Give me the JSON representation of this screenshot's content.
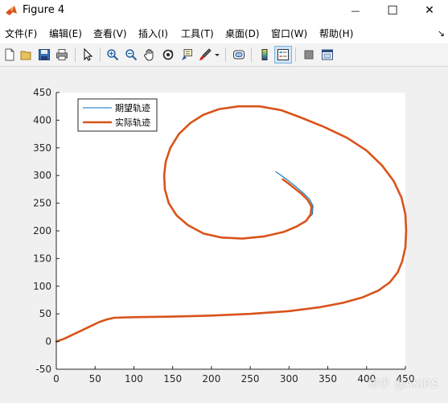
{
  "window": {
    "title": "Figure 4",
    "minimize_glyph": "—",
    "maximize_glyph": "☐",
    "close_glyph": "✕"
  },
  "menu": {
    "items": [
      "文件(F)",
      "编辑(E)",
      "查看(V)",
      "插入(I)",
      "工具(T)",
      "桌面(D)",
      "窗口(W)",
      "帮助(H)"
    ],
    "dock_glyph": "↘"
  },
  "toolbar": {
    "buttons": [
      "new-figure-icon",
      "open-file-icon",
      "save-icon",
      "print-icon",
      "select-pointer-icon",
      "zoom-in-icon",
      "zoom-out-icon",
      "pan-hand-icon",
      "rotate-3d-icon",
      "data-cursor-icon",
      "brush-icon",
      "brush-dropdown-icon",
      "link-plot-icon",
      "colorbar-icon",
      "legend-icon",
      "hide-plot-tools-icon",
      "show-plot-tools-icon"
    ]
  },
  "watermark": "知乎 @AKIRS",
  "chart_data": {
    "type": "line",
    "xlim": [
      0,
      450
    ],
    "ylim": [
      -50,
      450
    ],
    "xticks": [
      0,
      50,
      100,
      150,
      200,
      250,
      300,
      350,
      400,
      450
    ],
    "yticks": [
      -50,
      0,
      50,
      100,
      150,
      200,
      250,
      300,
      350,
      400,
      450
    ],
    "grid": false,
    "legend_placement": "top-left",
    "colors": {
      "desired": "#0072bd",
      "actual": "#d95319"
    },
    "series": [
      {
        "name": "期望轨迹",
        "color": "#0072bd",
        "points": [
          [
            0,
            0
          ],
          [
            10,
            5
          ],
          [
            25,
            15
          ],
          [
            40,
            25
          ],
          [
            55,
            35
          ],
          [
            65,
            40
          ],
          [
            73,
            43
          ],
          [
            100,
            44
          ],
          [
            150,
            45
          ],
          [
            200,
            47
          ],
          [
            250,
            50
          ],
          [
            300,
            55
          ],
          [
            340,
            62
          ],
          [
            370,
            70
          ],
          [
            395,
            80
          ],
          [
            415,
            92
          ],
          [
            430,
            107
          ],
          [
            440,
            125
          ],
          [
            446,
            145
          ],
          [
            450,
            170
          ],
          [
            451,
            200
          ],
          [
            450,
            230
          ],
          [
            445,
            260
          ],
          [
            435,
            290
          ],
          [
            420,
            318
          ],
          [
            400,
            345
          ],
          [
            375,
            368
          ],
          [
            345,
            388
          ],
          [
            315,
            405
          ],
          [
            290,
            418
          ],
          [
            262,
            425
          ],
          [
            235,
            425
          ],
          [
            210,
            420
          ],
          [
            190,
            410
          ],
          [
            173,
            395
          ],
          [
            158,
            375
          ],
          [
            147,
            350
          ],
          [
            141,
            325
          ],
          [
            139,
            300
          ],
          [
            140,
            275
          ],
          [
            145,
            250
          ],
          [
            155,
            228
          ],
          [
            170,
            210
          ],
          [
            190,
            195
          ],
          [
            213,
            188
          ],
          [
            240,
            186
          ],
          [
            268,
            190
          ],
          [
            293,
            198
          ],
          [
            310,
            208
          ],
          [
            322,
            218
          ],
          [
            330,
            230
          ],
          [
            331,
            245
          ],
          [
            326,
            258
          ],
          [
            317,
            270
          ],
          [
            307,
            282
          ],
          [
            297,
            293
          ],
          [
            288,
            302
          ],
          [
            283,
            307
          ]
        ]
      },
      {
        "name": "实际轨迹",
        "color": "#d95319",
        "points": [
          [
            0,
            0
          ],
          [
            10,
            5
          ],
          [
            25,
            15
          ],
          [
            40,
            25
          ],
          [
            55,
            35
          ],
          [
            65,
            40
          ],
          [
            75,
            43
          ],
          [
            100,
            44
          ],
          [
            150,
            45
          ],
          [
            200,
            47
          ],
          [
            250,
            50
          ],
          [
            300,
            55
          ],
          [
            340,
            62
          ],
          [
            370,
            70
          ],
          [
            395,
            80
          ],
          [
            415,
            92
          ],
          [
            430,
            107
          ],
          [
            440,
            125
          ],
          [
            446,
            145
          ],
          [
            450,
            170
          ],
          [
            451,
            200
          ],
          [
            450,
            230
          ],
          [
            445,
            260
          ],
          [
            435,
            290
          ],
          [
            420,
            318
          ],
          [
            400,
            345
          ],
          [
            375,
            368
          ],
          [
            345,
            388
          ],
          [
            315,
            405
          ],
          [
            290,
            418
          ],
          [
            262,
            425
          ],
          [
            235,
            425
          ],
          [
            210,
            420
          ],
          [
            190,
            410
          ],
          [
            173,
            395
          ],
          [
            158,
            375
          ],
          [
            147,
            350
          ],
          [
            141,
            325
          ],
          [
            139,
            300
          ],
          [
            140,
            275
          ],
          [
            145,
            250
          ],
          [
            155,
            228
          ],
          [
            170,
            210
          ],
          [
            190,
            195
          ],
          [
            213,
            188
          ],
          [
            240,
            186
          ],
          [
            268,
            190
          ],
          [
            293,
            198
          ],
          [
            310,
            208
          ],
          [
            322,
            218
          ],
          [
            328,
            230
          ],
          [
            329,
            244
          ],
          [
            324,
            256
          ],
          [
            316,
            267
          ],
          [
            307,
            277
          ],
          [
            299,
            286
          ],
          [
            292,
            293
          ]
        ]
      }
    ]
  }
}
